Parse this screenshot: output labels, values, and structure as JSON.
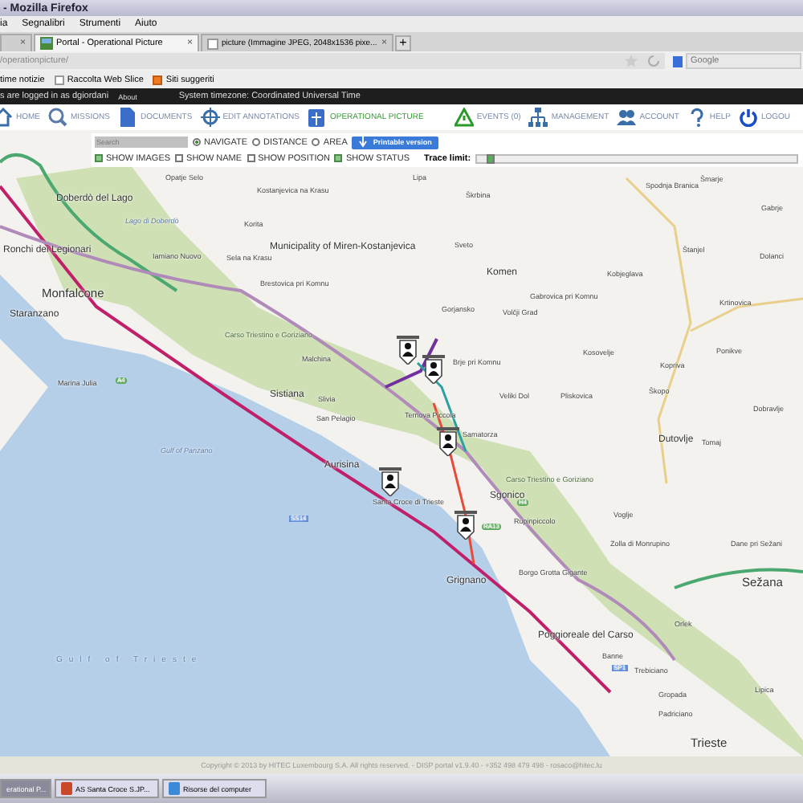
{
  "window": {
    "title": "- Mozilla Firefox"
  },
  "menu": [
    "ia",
    "Segnalibri",
    "Strumenti",
    "Aiuto"
  ],
  "tabs": [
    {
      "close": "×",
      "selected": false
    },
    {
      "label": "Portal - Operational Picture",
      "close": "×",
      "selected": true
    },
    {
      "label": "picture (Immagine JPEG, 2048x1536 pixe...",
      "close": "×",
      "selected": false
    }
  ],
  "new_tab": "+",
  "address": {
    "url": "/operationpicture/",
    "search_placeholder": "Google"
  },
  "bookmarks": [
    "time notizie",
    "Raccolta Web Slice",
    "Siti suggeriti"
  ],
  "session": {
    "user": "s are logged in as dgiordani",
    "about": "About",
    "timezone": "System timezone: Coordinated Universal Time"
  },
  "nav": [
    {
      "label": "HOME",
      "selected": false
    },
    {
      "label": "MISSIONS",
      "selected": false
    },
    {
      "label": "DOCUMENTS",
      "selected": false
    },
    {
      "label": "EDIT ANNOTATIONS",
      "selected": false
    },
    {
      "label": "OPERATIONAL PICTURE",
      "selected": true
    },
    {
      "label": "EVENTS (0)",
      "selected": false
    },
    {
      "label": "MANAGEMENT",
      "selected": false
    },
    {
      "label": "ACCOUNT",
      "selected": false
    },
    {
      "label": "HELP",
      "selected": false
    },
    {
      "label": "LOGOU",
      "selected": false
    }
  ],
  "controls": {
    "search_placeholder": "Search",
    "modes": [
      {
        "label": "NAVIGATE",
        "selected": true
      },
      {
        "label": "DISTANCE",
        "selected": false
      },
      {
        "label": "AREA",
        "selected": false
      }
    ],
    "print_button": "Printable version",
    "options": [
      {
        "label": "SHOW IMAGES",
        "checked": true
      },
      {
        "label": "SHOW NAME",
        "checked": false
      },
      {
        "label": "SHOW POSITION",
        "checked": false
      },
      {
        "label": "SHOW STATUS",
        "checked": true
      }
    ],
    "trace": {
      "label": "Trace limit:",
      "level": 0.03
    }
  },
  "map": {
    "places": [
      {
        "name": "Opatje Selo",
        "kind": "village"
      },
      {
        "name": "Doberdò del Lago",
        "kind": "town"
      },
      {
        "name": "Ronchi dei Legionari",
        "kind": "town"
      },
      {
        "name": "Monfalcone",
        "kind": "city"
      },
      {
        "name": "Staranzano",
        "kind": "town"
      },
      {
        "name": "Marina Julia",
        "kind": "village"
      },
      {
        "name": "Gulf of Panzano",
        "kind": "water"
      },
      {
        "name": "Lago di Doberdò",
        "kind": "water"
      },
      {
        "name": "Iamiano Nuovo",
        "kind": "village"
      },
      {
        "name": "Kostanjevica na Krasu",
        "kind": "village"
      },
      {
        "name": "Korita",
        "kind": "village"
      },
      {
        "name": "Municipality of Miren-Kostanjevica",
        "kind": "town"
      },
      {
        "name": "Sela na Krasu",
        "kind": "village"
      },
      {
        "name": "Brestovica pri Komnu",
        "kind": "village"
      },
      {
        "name": "Carso Triestino e Goriziano",
        "kind": "park"
      },
      {
        "name": "Malchina",
        "kind": "village"
      },
      {
        "name": "Sistiana",
        "kind": "town"
      },
      {
        "name": "Slivia",
        "kind": "village"
      },
      {
        "name": "San Pelagio",
        "kind": "village"
      },
      {
        "name": "Aurisina",
        "kind": "town"
      },
      {
        "name": "Lipa",
        "kind": "village"
      },
      {
        "name": "Škrbina",
        "kind": "village"
      },
      {
        "name": "Sveto",
        "kind": "village"
      },
      {
        "name": "Komen",
        "kind": "town"
      },
      {
        "name": "Kobjeglava",
        "kind": "village"
      },
      {
        "name": "Gabrovica pri Komnu",
        "kind": "village"
      },
      {
        "name": "Gorjansko",
        "kind": "village"
      },
      {
        "name": "Volčji Grad",
        "kind": "village"
      },
      {
        "name": "Brje pri Komnu",
        "kind": "village"
      },
      {
        "name": "Kosovelje",
        "kind": "village"
      },
      {
        "name": "Veliki Dol",
        "kind": "village"
      },
      {
        "name": "Pliskovica",
        "kind": "village"
      },
      {
        "name": "Kopriva",
        "kind": "village"
      },
      {
        "name": "Škopo",
        "kind": "village"
      },
      {
        "name": "Dutovlje",
        "kind": "town"
      },
      {
        "name": "Tomaj",
        "kind": "village"
      },
      {
        "name": "Spodnja Branica",
        "kind": "village"
      },
      {
        "name": "Šmarje",
        "kind": "village"
      },
      {
        "name": "Gabrje",
        "kind": "village"
      },
      {
        "name": "Štanjel",
        "kind": "village"
      },
      {
        "name": "Dolanci",
        "kind": "village"
      },
      {
        "name": "Krtinovica",
        "kind": "village"
      },
      {
        "name": "Ponikve",
        "kind": "village"
      },
      {
        "name": "Dobravlje",
        "kind": "village"
      },
      {
        "name": "Ternova Piccola",
        "kind": "village"
      },
      {
        "name": "Samatorza",
        "kind": "village"
      },
      {
        "name": "Carso Triestino e Goriziano",
        "kind": "park"
      },
      {
        "name": "Sgonico",
        "kind": "town"
      },
      {
        "name": "Santa Croce di Trieste",
        "kind": "village"
      },
      {
        "name": "Rupinpiccolo",
        "kind": "village"
      },
      {
        "name": "Voglje",
        "kind": "village"
      },
      {
        "name": "Zolla di Monrupino",
        "kind": "village"
      },
      {
        "name": "Dane pri Sežani",
        "kind": "village"
      },
      {
        "name": "Grignano",
        "kind": "town"
      },
      {
        "name": "Borgo Grotta Gigante",
        "kind": "village"
      },
      {
        "name": "Sežana",
        "kind": "city"
      },
      {
        "name": "Orlek",
        "kind": "village"
      },
      {
        "name": "Poggioreale del Carso",
        "kind": "town"
      },
      {
        "name": "Banne",
        "kind": "village"
      },
      {
        "name": "Trebiciano",
        "kind": "village"
      },
      {
        "name": "Gropada",
        "kind": "village"
      },
      {
        "name": "Padriciano",
        "kind": "village"
      },
      {
        "name": "Lipica",
        "kind": "village"
      },
      {
        "name": "Gulf of Trieste",
        "kind": "sea"
      },
      {
        "name": "Trieste",
        "kind": "city"
      },
      {
        "name": "A4",
        "kind": "motorway"
      },
      {
        "name": "SS14",
        "kind": "shield"
      },
      {
        "name": "RA13",
        "kind": "motorway"
      },
      {
        "name": "SP1",
        "kind": "shield"
      },
      {
        "name": "H4",
        "kind": "motorway"
      }
    ]
  },
  "footer": "Copyright © 2013 by HITEC Luxembourg S.A. All rights reserved. - DISP portal v1.9.40 - +352 498 479 498 - rosaco@hitec.lu",
  "taskbar": [
    {
      "label": "erational P...",
      "selected": true
    },
    {
      "label": "AS Santa Croce S.JP...",
      "selected": false
    },
    {
      "label": "Risorse del computer",
      "selected": false
    }
  ]
}
